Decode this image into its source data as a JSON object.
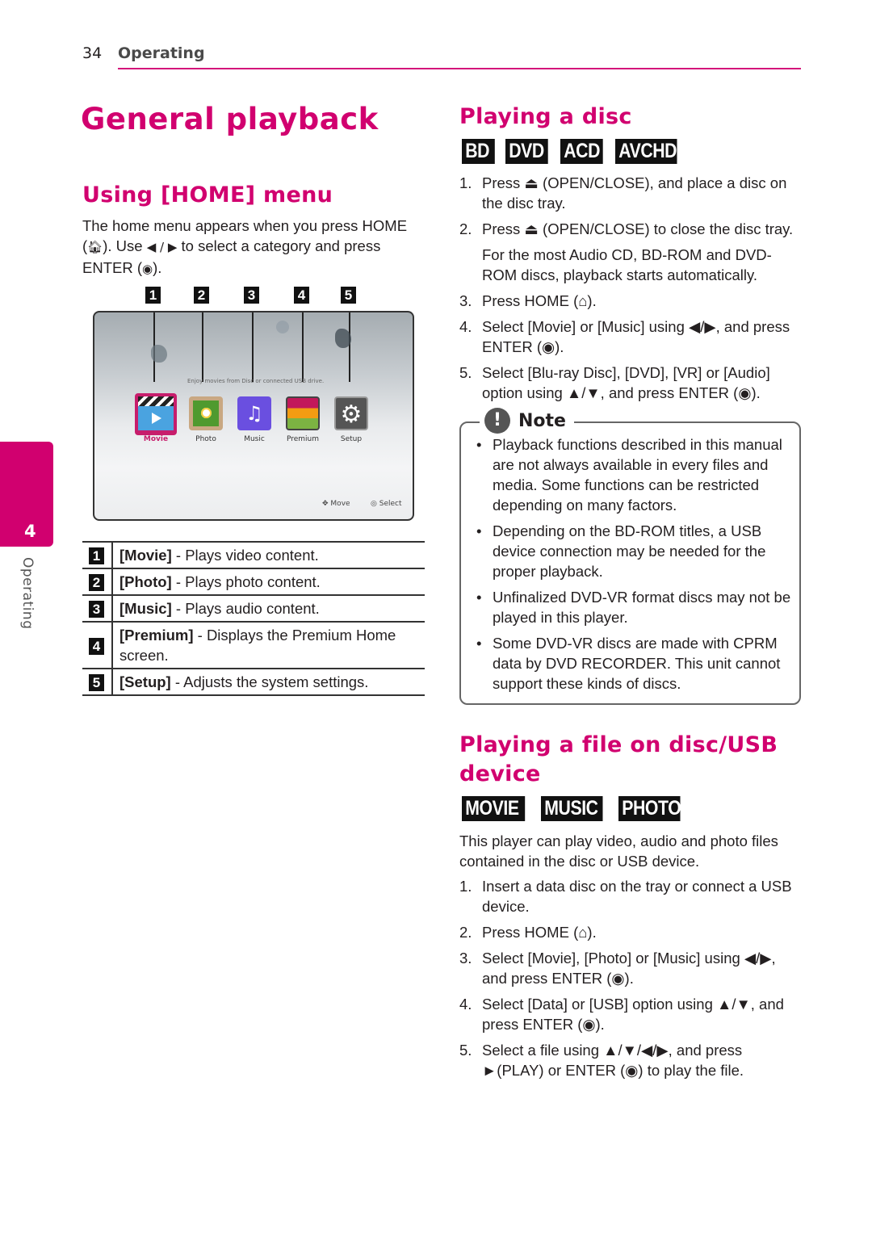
{
  "header": {
    "page_number": "34",
    "section": "Operating"
  },
  "side_tab": {
    "chapter": "4",
    "label": "Operating"
  },
  "title": "General playback",
  "home_menu": {
    "heading": "Using [HOME] menu",
    "intro_1": "The home menu appears when you press HOME",
    "intro_2a": "(",
    "intro_2b": "). Use ",
    "intro_2c": " to select a category and press",
    "intro_3a": "ENTER (",
    "intro_3b": ").",
    "callouts": [
      "1",
      "2",
      "3",
      "4",
      "5"
    ],
    "screen": {
      "hint": "Enjoy movies from Disc or connected USB drive.",
      "apps": [
        {
          "label": "Movie",
          "selected": true
        },
        {
          "label": "Photo",
          "selected": false
        },
        {
          "label": "Music",
          "selected": false
        },
        {
          "label": "Premium",
          "selected": false
        },
        {
          "label": "Setup",
          "selected": false
        }
      ],
      "move_label": "Move",
      "select_label": "Select"
    },
    "table": [
      {
        "num": "1",
        "name": "[Movie]",
        "desc": " - Plays video content."
      },
      {
        "num": "2",
        "name": "[Photo]",
        "desc": " - Plays photo content."
      },
      {
        "num": "3",
        "name": "[Music]",
        "desc": " - Plays audio content."
      },
      {
        "num": "4",
        "name": "[Premium]",
        "desc": " - Displays the Premium Home screen."
      },
      {
        "num": "5",
        "name": "[Setup]",
        "desc": " - Adjusts the system settings."
      }
    ]
  },
  "playing_disc": {
    "heading": "Playing a disc",
    "tags": [
      "BD",
      "DVD",
      "ACD",
      "AVCHD"
    ],
    "steps": [
      {
        "n": "1.",
        "text": "Press ⏏ (OPEN/CLOSE), and place a disc on the disc tray."
      },
      {
        "n": "2.",
        "text": "Press ⏏ (OPEN/CLOSE) to close the disc tray.",
        "sub": "For the most Audio CD, BD-ROM and DVD-ROM discs, playback starts automatically."
      },
      {
        "n": "3.",
        "text": "Press HOME (⌂)."
      },
      {
        "n": "4.",
        "text": "Select [Movie] or [Music] using ◀/▶, and press ENTER (◉)."
      },
      {
        "n": "5.",
        "text": "Select [Blu-ray Disc], [DVD], [VR] or [Audio] option using ▲/▼, and press ENTER (◉)."
      }
    ]
  },
  "note": {
    "icon": "!",
    "title": "Note",
    "items": [
      "Playback functions described in this manual are not always available in every files and media. Some functions can be restricted depending on many factors.",
      "Depending on the BD-ROM titles, a USB device connection may be needed for the proper playback.",
      "Unfinalized DVD-VR format discs may not be played in this player.",
      "Some DVD-VR discs are made with CPRM data by DVD RECORDER. This unit cannot support these kinds of discs."
    ]
  },
  "playing_file": {
    "heading_1": "Playing a file on disc/USB",
    "heading_2": "device",
    "tags": [
      "MOVIE",
      "MUSIC",
      "PHOTO"
    ],
    "intro": "This player can play video, audio and photo files contained in the disc or USB device.",
    "steps": [
      {
        "n": "1.",
        "text": "Insert a data disc on the tray or connect a USB device."
      },
      {
        "n": "2.",
        "text": "Press HOME (⌂)."
      },
      {
        "n": "3.",
        "text": "Select [Movie], [Photo] or [Music] using ◀/▶, and press ENTER (◉)."
      },
      {
        "n": "4.",
        "text": "Select [Data] or [USB] option using ▲/▼, and press ENTER (◉)."
      },
      {
        "n": "5.",
        "text": "Select a file using ▲/▼/◀/▶, and press ►(PLAY) or ENTER (◉) to play the file."
      }
    ]
  },
  "colors": {
    "accent": "#d1006f",
    "rule": "#d4157a"
  }
}
